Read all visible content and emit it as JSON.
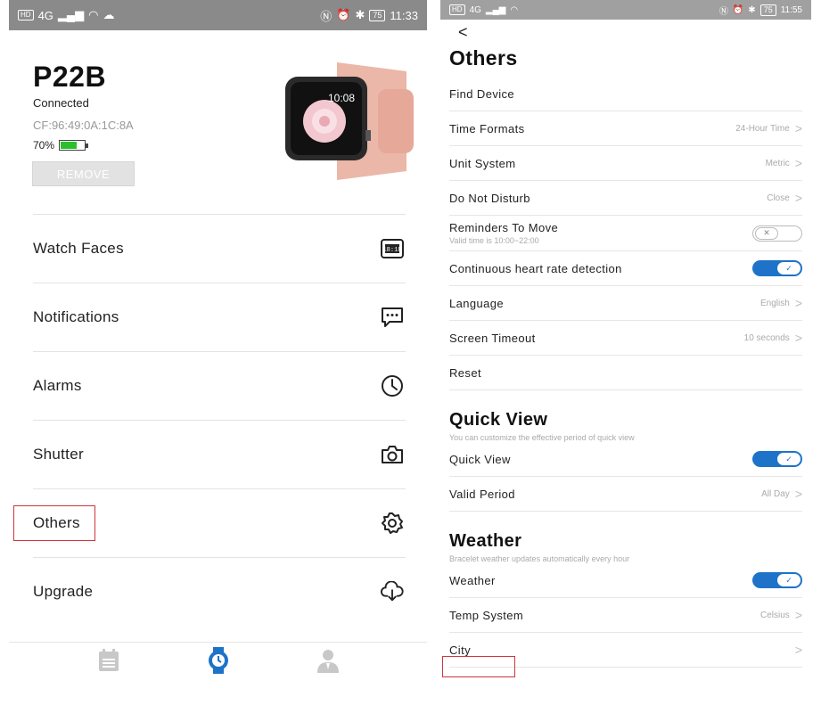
{
  "left": {
    "statusbar": {
      "left_badge": "HD",
      "signal": "4G",
      "time": "11:33",
      "battery": "75"
    },
    "device": {
      "name": "P22B",
      "status": "Connected",
      "mac": "CF:96:49:0A:1C:8A",
      "battery_text": "70%",
      "battery_level": 0.7
    },
    "watch_time": "10:08",
    "remove_label": "REMOVE",
    "menu": [
      {
        "label": "Watch Faces",
        "icon": "watch-face-icon"
      },
      {
        "label": "Notifications",
        "icon": "message-icon"
      },
      {
        "label": "Alarms",
        "icon": "clock-icon"
      },
      {
        "label": "Shutter",
        "icon": "camera-icon"
      },
      {
        "label": "Others",
        "icon": "gear-icon"
      },
      {
        "label": "Upgrade",
        "icon": "cloud-download-icon"
      }
    ],
    "tabs": [
      {
        "icon": "calendar-icon",
        "color": "#c8c8c8"
      },
      {
        "icon": "watch-icon",
        "color": "#1e73c8"
      },
      {
        "icon": "person-icon",
        "color": "#c8c8c8"
      }
    ]
  },
  "right": {
    "statusbar": {
      "left_badge": "HD",
      "signal": "4G",
      "time": "11:55",
      "battery": "75"
    },
    "back": "<",
    "title": "Others",
    "rows": [
      {
        "label": "Find Device"
      },
      {
        "label": "Time Formats",
        "value": "24-Hour Time",
        "chevron": true
      },
      {
        "label": "Unit System",
        "value": "Metric",
        "chevron": true
      },
      {
        "label": "Do Not Disturb",
        "value": "Close",
        "chevron": true
      },
      {
        "label": "Reminders To Move",
        "sub": "Valid time is 10:00~22:00",
        "toggle": "off"
      },
      {
        "label": "Continuous heart rate detection",
        "toggle": "on"
      },
      {
        "label": "Language",
        "value": "English",
        "chevron": true
      },
      {
        "label": "Screen Timeout",
        "value": "10 seconds",
        "chevron": true
      },
      {
        "label": "Reset"
      }
    ],
    "quick_view": {
      "title": "Quick View",
      "desc": "You can customize the effective period of quick view",
      "rows": [
        {
          "label": "Quick View",
          "toggle": "on"
        },
        {
          "label": "Valid Period",
          "value": "All Day",
          "chevron": true
        }
      ]
    },
    "weather": {
      "title": "Weather",
      "desc": "Bracelet weather updates automatically every hour",
      "rows": [
        {
          "label": "Weather",
          "toggle": "on"
        },
        {
          "label": "Temp System",
          "value": "Celsius",
          "chevron": true
        },
        {
          "label": "City",
          "chevron": true
        }
      ]
    },
    "accent": "#1e73c8",
    "highlight": "#d0343a"
  }
}
